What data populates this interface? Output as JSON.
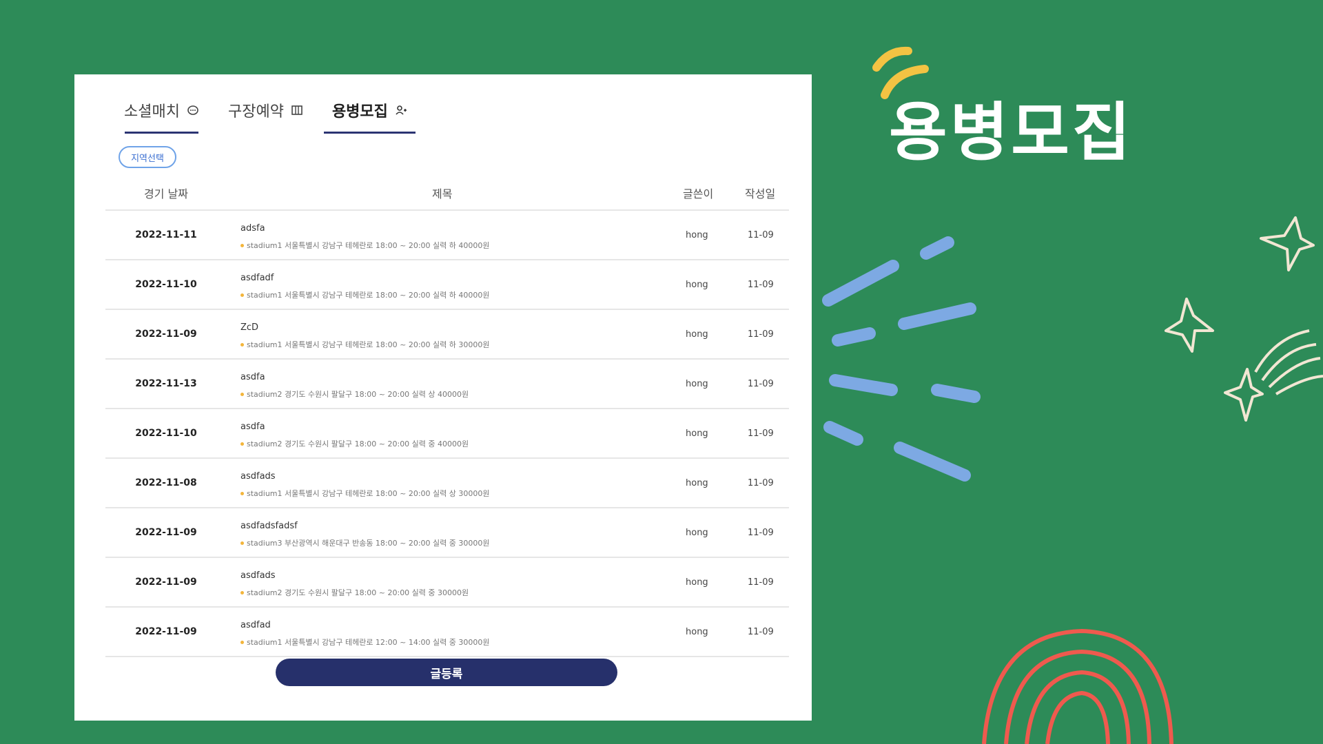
{
  "tabs": [
    {
      "label": "소셜매치",
      "icon": "chat-bubble-icon",
      "active": false
    },
    {
      "label": "구장예약",
      "icon": "stadium-icon",
      "active": false
    },
    {
      "label": "용병모집",
      "icon": "add-person-icon",
      "active": true
    }
  ],
  "filter": {
    "region_button": "지역선택"
  },
  "table": {
    "headers": {
      "date": "경기 날짜",
      "title": "제목",
      "author": "글쓴이",
      "created": "작성일"
    },
    "rows": [
      {
        "date": "2022-11-11",
        "title": "adsfa",
        "sub": "stadium1 서울특별시 강남구 테헤란로 18:00 ~ 20:00 실력 하 40000원",
        "author": "hong",
        "created": "11-09"
      },
      {
        "date": "2022-11-10",
        "title": "asdfadf",
        "sub": "stadium1 서울특별시 강남구 테헤란로 18:00 ~ 20:00 실력 하 40000원",
        "author": "hong",
        "created": "11-09"
      },
      {
        "date": "2022-11-09",
        "title": "ZcD",
        "sub": "stadium1 서울특별시 강남구 테헤란로 18:00 ~ 20:00 실력 하 30000원",
        "author": "hong",
        "created": "11-09"
      },
      {
        "date": "2022-11-13",
        "title": "asdfa",
        "sub": "stadium2 경기도 수원시 팔달구 18:00 ~ 20:00 실력 상 40000원",
        "author": "hong",
        "created": "11-09"
      },
      {
        "date": "2022-11-10",
        "title": "asdfa",
        "sub": "stadium2 경기도 수원시 팔달구 18:00 ~ 20:00 실력 중 40000원",
        "author": "hong",
        "created": "11-09"
      },
      {
        "date": "2022-11-08",
        "title": "asdfads",
        "sub": "stadium1 서울특별시 강남구 테헤란로 18:00 ~ 20:00 실력 상 30000원",
        "author": "hong",
        "created": "11-09"
      },
      {
        "date": "2022-11-09",
        "title": "asdfadsfadsf",
        "sub": "stadium3 부산광역시 해운대구 반송동 18:00 ~ 20:00 실력 중 30000원",
        "author": "hong",
        "created": "11-09"
      },
      {
        "date": "2022-11-09",
        "title": "asdfads",
        "sub": "stadium2 경기도 수원시 팔달구 18:00 ~ 20:00 실력 중 30000원",
        "author": "hong",
        "created": "11-09"
      },
      {
        "date": "2022-11-09",
        "title": "asdfad",
        "sub": "stadium1 서울특별시 강남구 테헤란로 12:00 ~ 14:00 실력 중 30000원",
        "author": "hong",
        "created": "11-09"
      }
    ]
  },
  "submit_button": "글등록",
  "heading": "용병모집",
  "colors": {
    "background": "#2d8b58",
    "navy": "#26306b",
    "accent_blue": "#7da9e3",
    "star": "#f2e6d3",
    "arc": "#ef5a4e",
    "yellow": "#f3c343"
  }
}
